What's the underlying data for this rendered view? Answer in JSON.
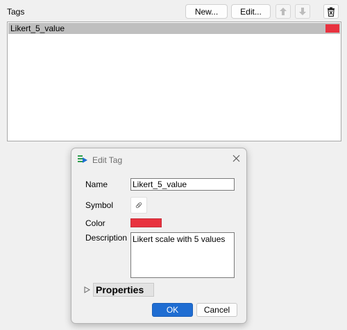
{
  "tags_panel": {
    "label": "Tags",
    "new_label": "New...",
    "edit_label": "Edit...",
    "up_icon": "arrow-up-icon",
    "down_icon": "arrow-down-icon",
    "delete_icon": "trash-icon",
    "items": [
      {
        "label": "Likert_5_value",
        "color": "#e8323f",
        "selected": true
      }
    ]
  },
  "dialog": {
    "title": "Edit Tag",
    "title_icon": "tag-edit-icon",
    "close_icon": "close-icon",
    "name_label": "Name",
    "name_value": "Likert_5_value",
    "symbol_label": "Symbol",
    "symbol_icon": "link-icon",
    "color_label": "Color",
    "color_value": "#e8323f",
    "description_label": "Description",
    "description_value": "Likert scale with 5 values",
    "properties_label": "Properties",
    "ok_label": "OK",
    "cancel_label": "Cancel"
  }
}
